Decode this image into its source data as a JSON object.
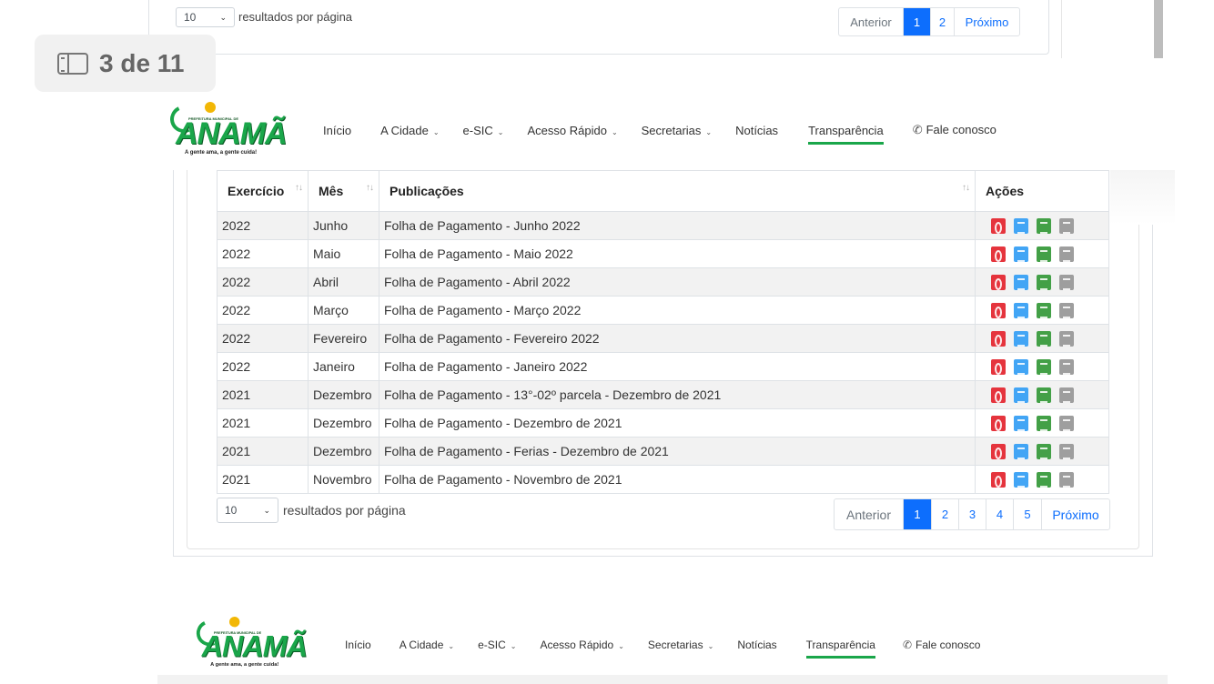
{
  "top_section": {
    "per_page_value": "10",
    "results_label": "resultados por página",
    "pagination": {
      "prev": "Anterior",
      "pages": [
        "1",
        "2"
      ],
      "active": "1",
      "next": "Próximo"
    }
  },
  "slide_counter": {
    "icon": "side-panel-icon",
    "text": "3 de 11"
  },
  "nav": {
    "logo": {
      "small_text": "PREFEITURA MUNICIPAL DE",
      "name": "ANAMÃ",
      "tagline": "A gente ama, a gente cuida!"
    },
    "items": [
      {
        "label": "Início",
        "dropdown": false
      },
      {
        "label": "A Cidade",
        "dropdown": true
      },
      {
        "label": "e-SIC",
        "dropdown": true
      },
      {
        "label": "Acesso Rápido",
        "dropdown": true
      },
      {
        "label": "Secretarias",
        "dropdown": true
      },
      {
        "label": "Notícias",
        "dropdown": false
      },
      {
        "label": "Transparência",
        "dropdown": false,
        "active": true
      },
      {
        "label": "Fale conosco",
        "dropdown": false,
        "icon": "phone-icon"
      }
    ],
    "accent_color": "#1aa64a"
  },
  "table": {
    "headers": {
      "exercicio": "Exercício",
      "mes": "Mês",
      "publicacoes": "Publicações",
      "acoes": "Ações"
    },
    "sort_glyph": "↑↓",
    "rows": [
      {
        "exercicio": "2022",
        "mes": "Junho",
        "publicacao": "Folha de Pagamento - Junho 2022"
      },
      {
        "exercicio": "2022",
        "mes": "Maio",
        "publicacao": "Folha de Pagamento - Maio 2022"
      },
      {
        "exercicio": "2022",
        "mes": "Abril",
        "publicacao": "Folha de Pagamento - Abril 2022"
      },
      {
        "exercicio": "2022",
        "mes": "Março",
        "publicacao": "Folha de Pagamento - Março 2022"
      },
      {
        "exercicio": "2022",
        "mes": "Fevereiro",
        "publicacao": "Folha de Pagamento - Fevereiro 2022"
      },
      {
        "exercicio": "2022",
        "mes": "Janeiro",
        "publicacao": "Folha de Pagamento - Janeiro 2022"
      },
      {
        "exercicio": "2021",
        "mes": "Dezembro",
        "publicacao": "Folha de Pagamento - 13°-02º parcela - Dezembro de 2021"
      },
      {
        "exercicio": "2021",
        "mes": "Dezembro",
        "publicacao": "Folha de Pagamento - Dezembro de 2021"
      },
      {
        "exercicio": "2021",
        "mes": "Dezembro",
        "publicacao": "Folha de Pagamento - Ferias - Dezembro de 2021"
      },
      {
        "exercicio": "2021",
        "mes": "Novembro",
        "publicacao": "Folha de Pagamento - Novembro de 2021"
      }
    ],
    "action_icons": [
      "pdf-icon",
      "word-icon",
      "excel-icon",
      "text-icon"
    ],
    "action_colors": {
      "pdf": "#e5343d",
      "word": "#42a5f5",
      "excel": "#43a047",
      "text": "#9e9e9e"
    }
  },
  "bottom_controls": {
    "per_page_value": "10",
    "results_label": "resultados por página",
    "pagination": {
      "prev": "Anterior",
      "pages": [
        "1",
        "2",
        "3",
        "4",
        "5"
      ],
      "active": "1",
      "next": "Próximo"
    }
  },
  "accent_blue": "#0d6efd"
}
